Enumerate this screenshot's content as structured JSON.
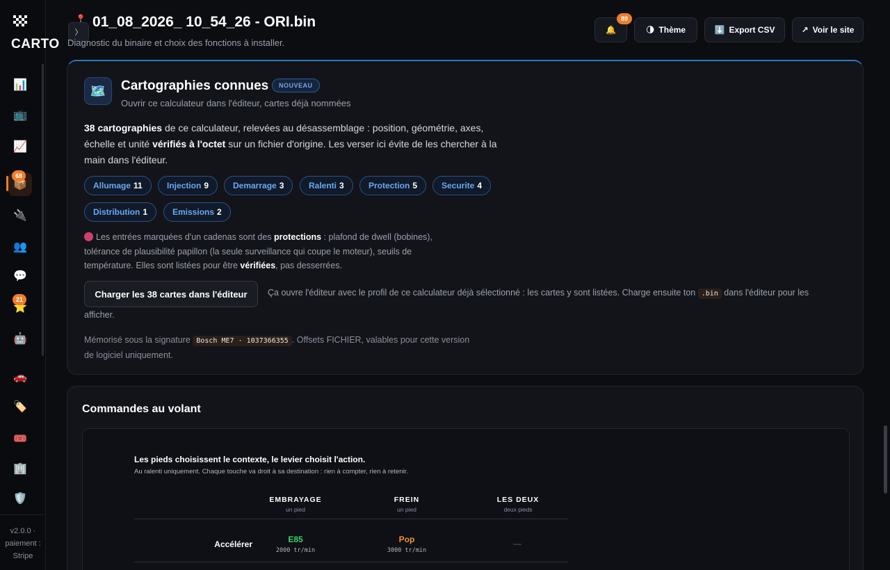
{
  "app": {
    "logo_text": "CARTO",
    "version": "v2.0.0 · paiement : Stripe"
  },
  "header": {
    "title": "01_08_2026_ 10_54_26 - ORI.bin",
    "subtitle": "Diagnostic du binaire et choix des fonctions à installer.",
    "notifications_count": "89",
    "theme_label": "Thème",
    "export_label": "Export CSV",
    "site_label": "Voir le site"
  },
  "sidebar": {
    "badges": {
      "active_item": "68",
      "favorites": "21"
    },
    "items": [
      "dashboard",
      "tv",
      "trend",
      "package",
      "plug",
      "users",
      "chat",
      "star",
      "robot",
      "car",
      "tag",
      "ticket",
      "building",
      "shield"
    ]
  },
  "cartographies": {
    "title": "Cartographies connues",
    "badge": "NOUVEAU",
    "subtitle": "Ouvrir ce calculateur dans l'éditeur, cartes déjà nommées",
    "desc_count": "38 cartographies",
    "desc_part1": " de ce calculateur, relevées au désassemblage : position, géométrie, axes, échelle et unité ",
    "desc_verified": "vérifiés à l'octet",
    "desc_part2": " sur un fichier d'origine. Les verser ici évite de les chercher à la main dans l'éditeur.",
    "chips": [
      {
        "label": "Allumage",
        "count": "11"
      },
      {
        "label": "Injection",
        "count": "9"
      },
      {
        "label": "Demarrage",
        "count": "3"
      },
      {
        "label": "Ralenti",
        "count": "3"
      },
      {
        "label": "Protection",
        "count": "5"
      },
      {
        "label": "Securite",
        "count": "4"
      },
      {
        "label": "Distribution",
        "count": "1"
      },
      {
        "label": "Emissions",
        "count": "2"
      }
    ],
    "warn_part1": "Les entrées marquées d'un cadenas sont des ",
    "warn_protections": "protections",
    "warn_part2": " : plafond de dwell (bobines), tolérance de plausibilité papillon (la seule surveillance qui coupe le moteur), seuils de température. Elles sont listées pour être ",
    "warn_verifiees": "vérifiées",
    "warn_part3": ", pas desserrées.",
    "load_button": "Charger les 38 cartes dans l'éditeur",
    "load_text_part1": "Ça ouvre l'éditeur avec le profil de ce calculateur déjà sélectionné : les cartes y sont listées. Charge ensuite ton ",
    "load_code": ".bin",
    "load_text_part2": " dans l'éditeur pour les",
    "load_text_part3": "afficher.",
    "memo_part1": "Mémorisé sous la signature ",
    "memo_code": "Bosch ME7 · 1037366355",
    "memo_part2": ". Offsets FICHIER, valables pour cette version de logiciel uniquement."
  },
  "commandes": {
    "title": "Commandes au volant",
    "inner_title": "Les pieds choisissent le contexte, le levier choisit l'action.",
    "inner_sub": "Au ralenti uniquement. Chaque touche va droit à sa destination : rien à compter, rien à retenir.",
    "columns": [
      {
        "head": "EMBRAYAGE",
        "sub": "un pied"
      },
      {
        "head": "FREIN",
        "sub": "un pied"
      },
      {
        "head": "LES DEUX",
        "sub": "deux pieds"
      }
    ],
    "rows": [
      {
        "label": "Accélérer",
        "cells": [
          {
            "value": "E85",
            "rpm": "2000 tr/min",
            "color": "#3ecf6a"
          },
          {
            "value": "Pop",
            "rpm": "3000 tr/min",
            "color": "#f0932a"
          },
          {
            "value": "—",
            "rpm": "",
            "color": "#5a5f6a"
          }
        ]
      }
    ]
  }
}
